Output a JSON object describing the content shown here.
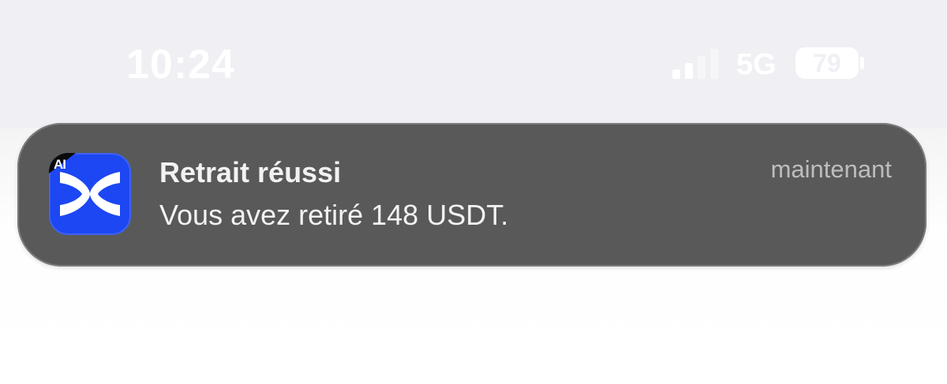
{
  "status_bar": {
    "time": "10:24",
    "network": "5G",
    "battery_level": "79",
    "signal_bars_active": 2,
    "signal_bars_total": 4
  },
  "notification": {
    "app_icon": "exchange-x-icon",
    "app_icon_badge": "AI",
    "title": "Retrait réussi",
    "body": "Vous avez retiré 148 USDT.",
    "timestamp": "maintenant"
  },
  "colors": {
    "notification_bg": "#595959",
    "app_icon_bg": "#1d47f2",
    "status_bar_bg": "#efeff4"
  }
}
